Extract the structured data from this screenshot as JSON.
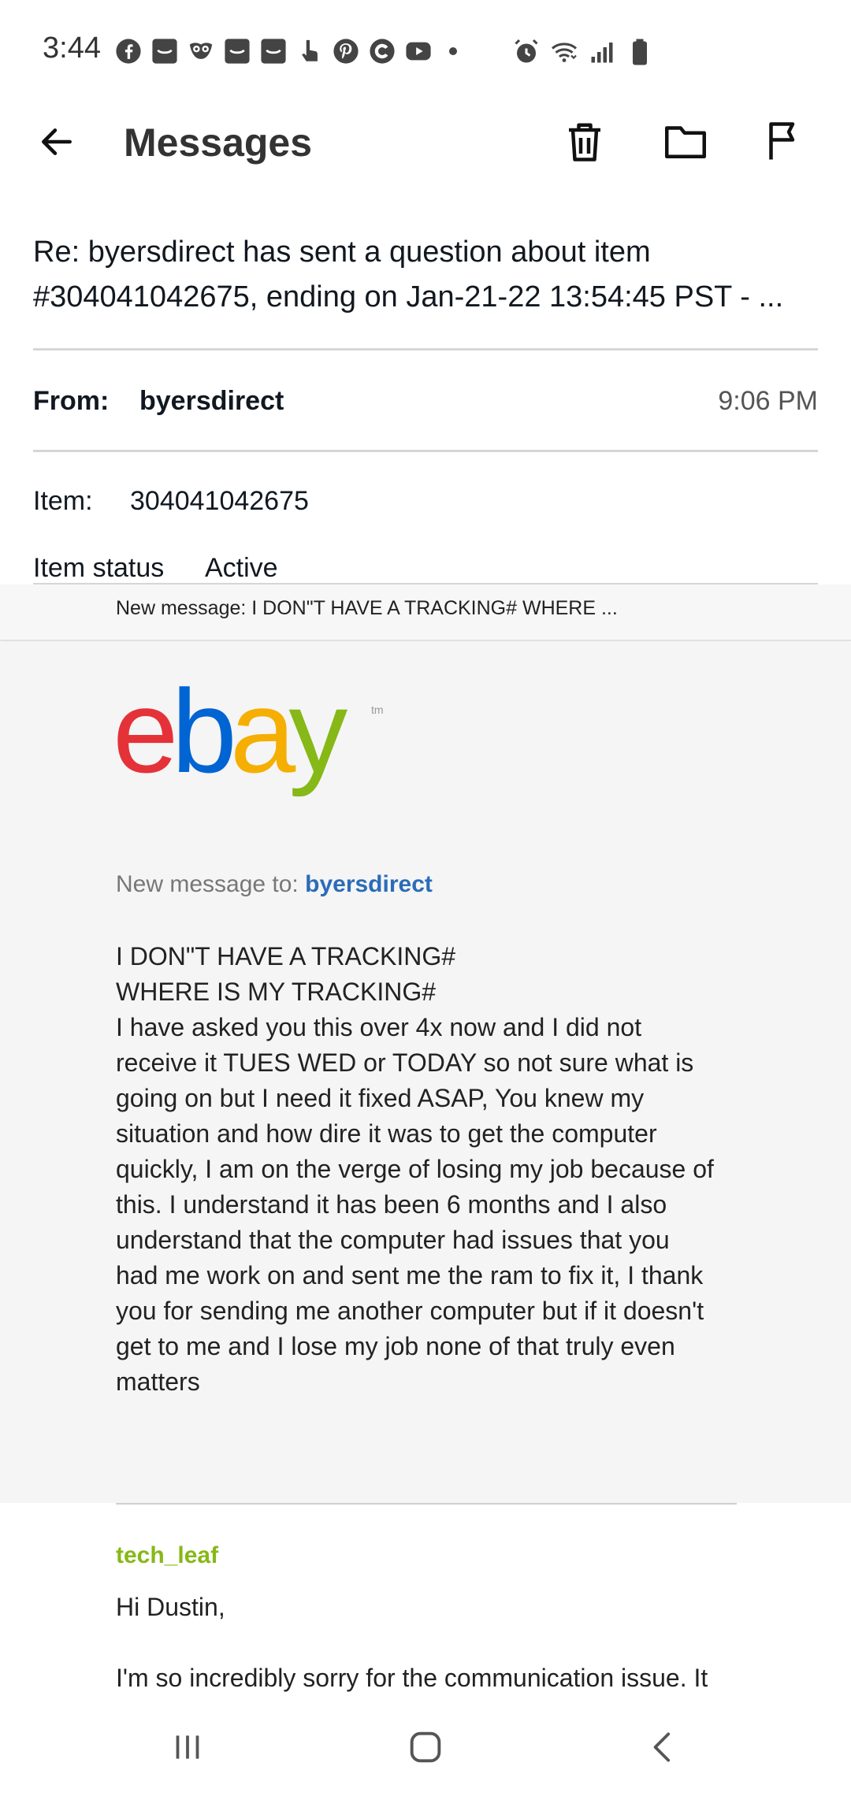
{
  "status_bar": {
    "time": "3:44",
    "notification_icons": [
      "facebook-icon",
      "inbox-icon",
      "owl-icon",
      "inbox-icon",
      "inbox-icon",
      "hand-icon",
      "pinterest-icon",
      "c-icon",
      "youtube-icon"
    ],
    "system_icons": [
      "alarm-icon",
      "wifi-icon",
      "signal-icon",
      "battery-icon"
    ]
  },
  "app_bar": {
    "title": "Messages",
    "actions": [
      "delete-icon",
      "folder-icon",
      "flag-icon"
    ]
  },
  "message": {
    "subject_line1": "Re: byersdirect has sent a question about item",
    "subject_line2": "#304041042675, ending on Jan-21-22 13:54:45 PST - ...",
    "from_label": "From:",
    "from_value": "byersdirect",
    "time": "9:06 PM",
    "item_label": "Item:",
    "item_value": "304041042675",
    "status_label": "Item status",
    "status_value": "Active"
  },
  "preview": {
    "text": "New message: I DON\"T HAVE A TRACKING# WHERE ..."
  },
  "brand": {
    "logo_text": "ebay",
    "tm": "tm",
    "colors": {
      "e": "#e53238",
      "b": "#0064d2",
      "a": "#f5af02",
      "y": "#86b817"
    }
  },
  "body": {
    "to_label": "New message to:",
    "to_name": "byersdirect",
    "lines": [
      "I DON\"T HAVE A TRACKING#",
      "WHERE IS MY TRACKING#",
      "I have asked you this over 4x now and I did not",
      "receive it TUES WED or TODAY so not sure what is",
      "going on but I need it fixed ASAP, You knew my",
      "situation and how dire it was to get the computer",
      "quickly, I am on the verge of losing my job because of",
      "this. I understand it has been 6 months and I also",
      "understand that the computer had issues that you",
      "had me work on and sent me the ram to fix it, I thank",
      "you for sending me another computer but if it doesn't",
      "get to me and I lose my job none of that truly even",
      "matters"
    ]
  },
  "reply": {
    "sender": "tech_leaf",
    "greeting": "Hi Dustin,",
    "body_start": "I'm so incredibly sorry for the communication issue. It"
  },
  "nav_bar": {
    "buttons": [
      "recent-apps-icon",
      "home-icon",
      "back-nav-icon"
    ]
  }
}
